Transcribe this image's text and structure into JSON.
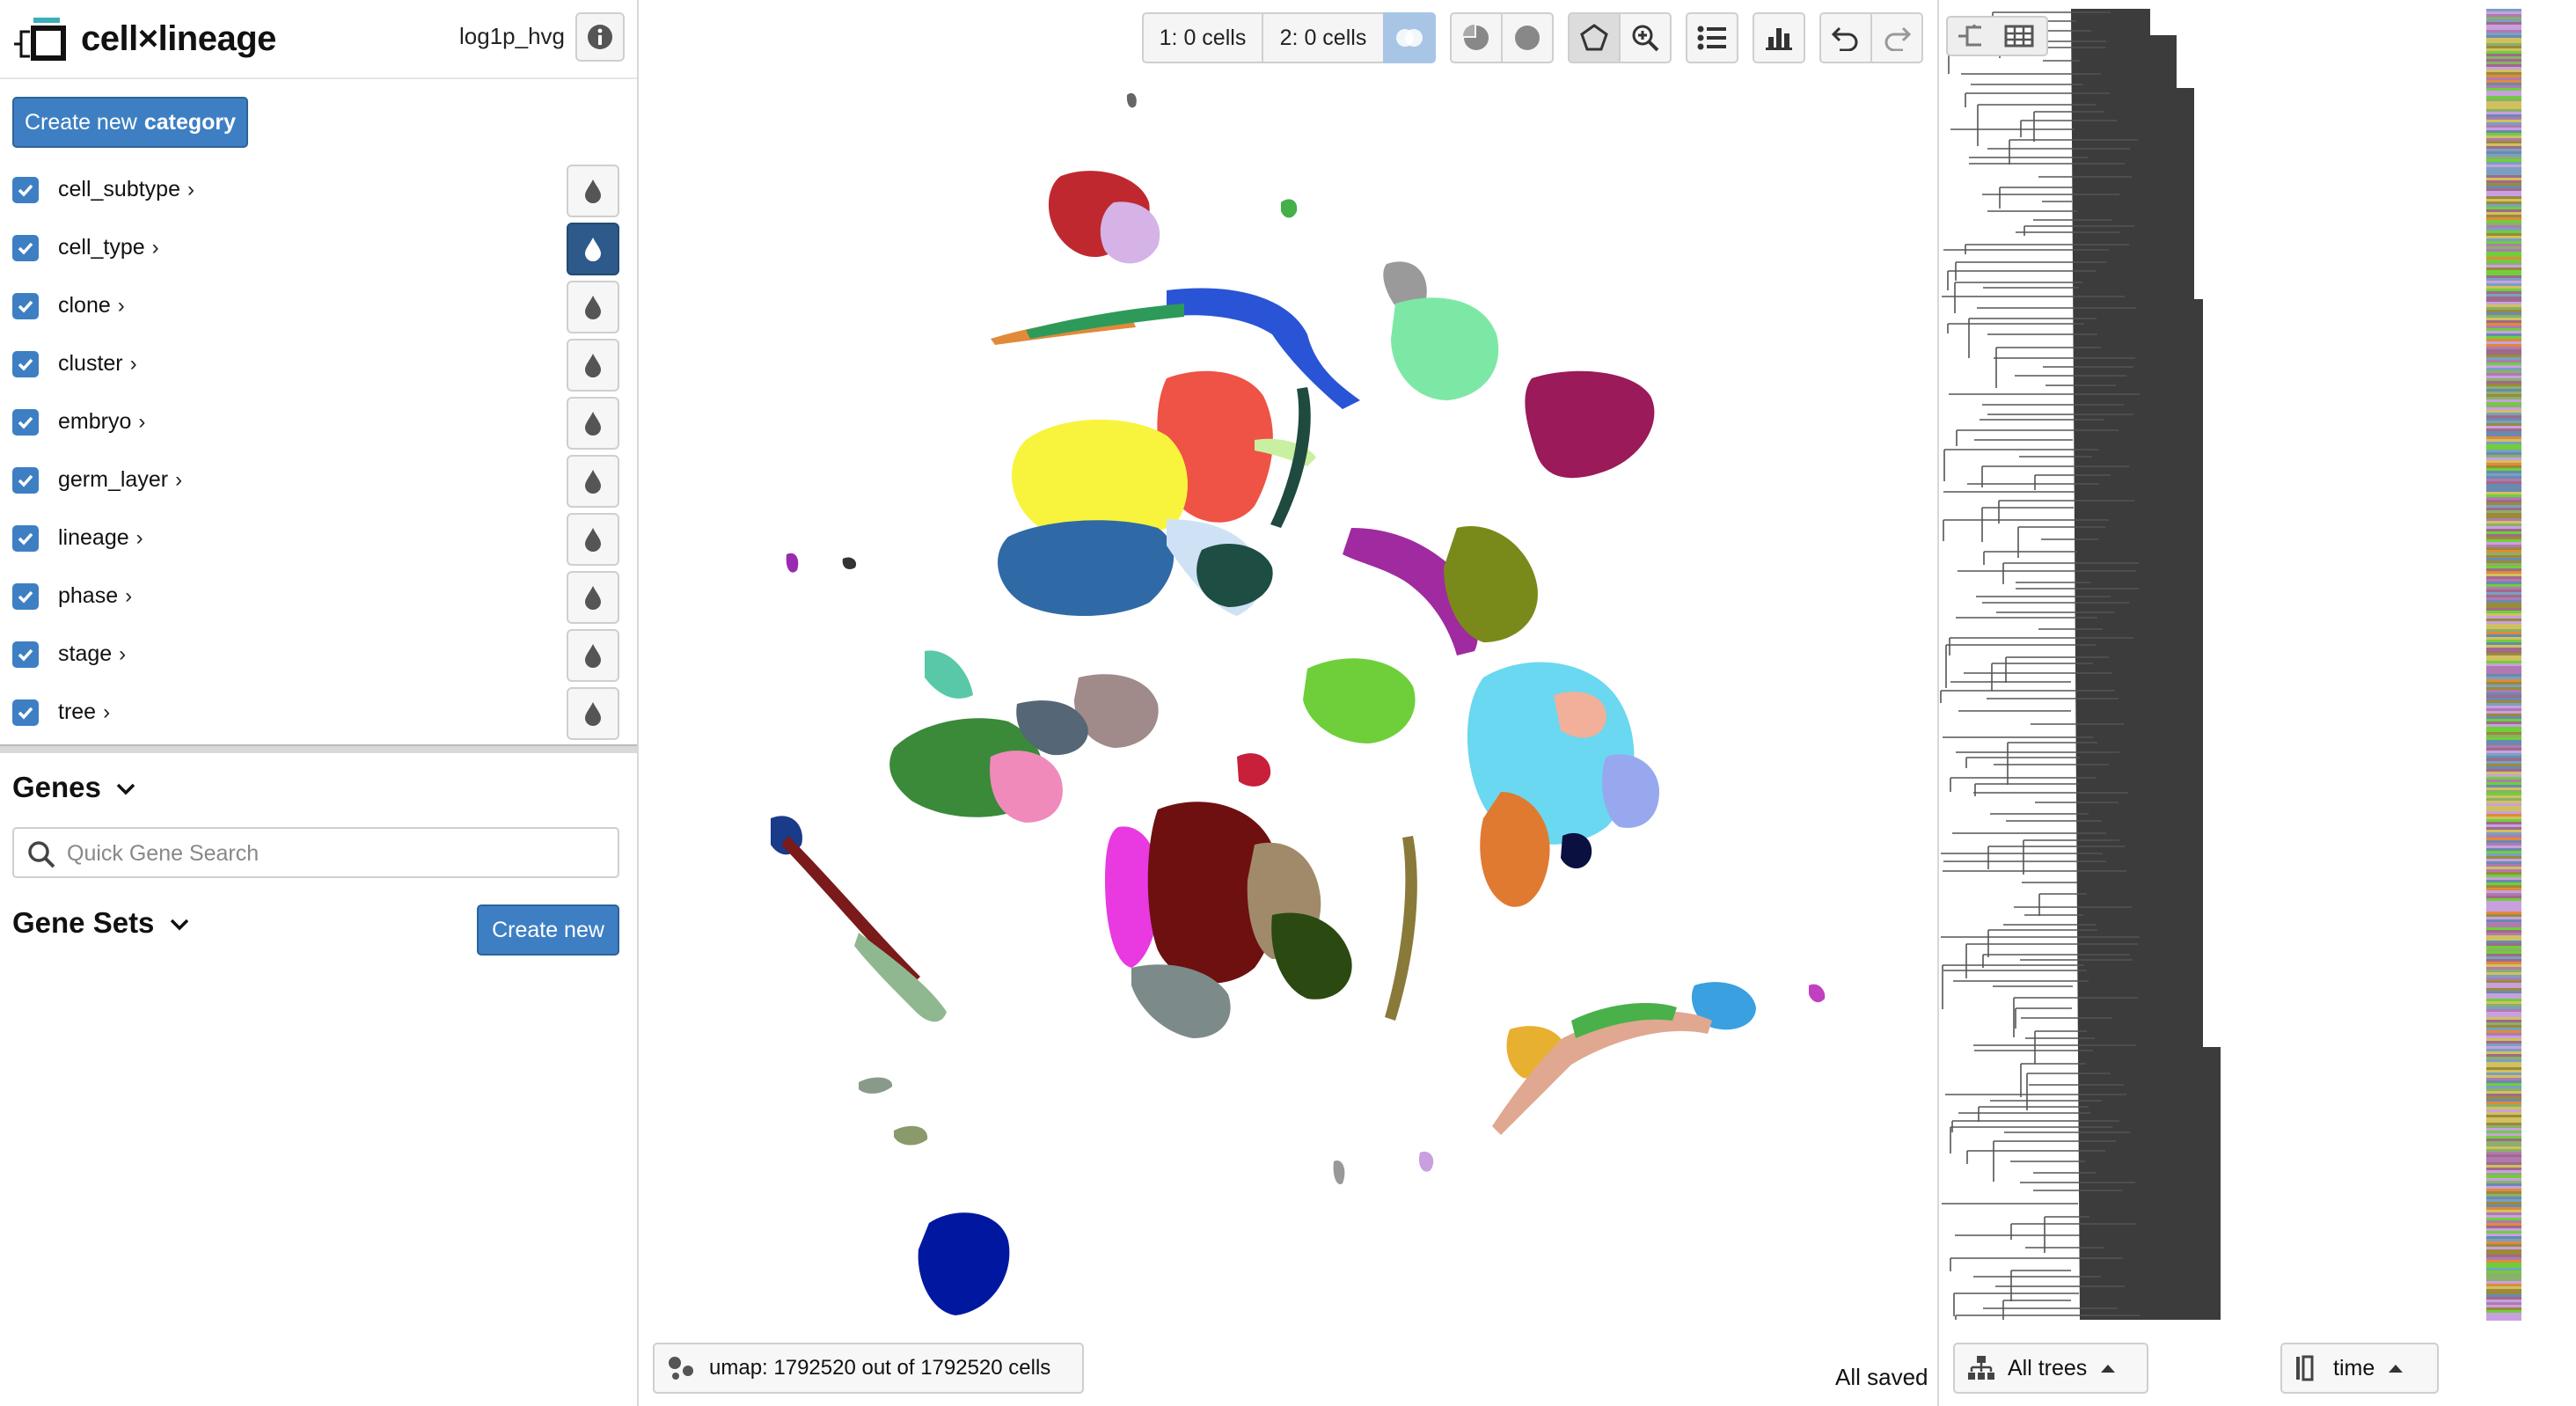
{
  "app": {
    "title": "cell×lineage",
    "layer": "log1p_hvg"
  },
  "categories": {
    "create_label_prefix": "Create new",
    "create_label_bold": "category",
    "items": [
      {
        "label": "cell_subtype",
        "checked": true,
        "active": false
      },
      {
        "label": "cell_type",
        "checked": true,
        "active": true
      },
      {
        "label": "clone",
        "checked": true,
        "active": false
      },
      {
        "label": "cluster",
        "checked": true,
        "active": false
      },
      {
        "label": "embryo",
        "checked": true,
        "active": false
      },
      {
        "label": "germ_layer",
        "checked": true,
        "active": false
      },
      {
        "label": "lineage",
        "checked": true,
        "active": false
      },
      {
        "label": "phase",
        "checked": true,
        "active": false
      },
      {
        "label": "stage",
        "checked": true,
        "active": false
      },
      {
        "label": "tree",
        "checked": true,
        "active": false
      }
    ]
  },
  "genes": {
    "title": "Genes",
    "search_placeholder": "Quick Gene Search"
  },
  "gene_sets": {
    "title": "Gene Sets",
    "create_label": "Create new"
  },
  "toolbar": {
    "selection_1": "1: 0 cells",
    "selection_2": "2: 0 cells",
    "icons": [
      "venn-icon",
      "pie-icon",
      "circle-icon",
      "lasso-icon",
      "zoom-icon",
      "list-icon",
      "histogram-icon",
      "undo-icon",
      "redo-icon"
    ]
  },
  "embedding": {
    "label": "umap: 1792520 out of 1792520 cells"
  },
  "status": {
    "save": "All saved"
  },
  "tree": {
    "trees_label": "All trees",
    "time_label": "time"
  },
  "colors": {
    "accent": "#3e7fc3",
    "active_color_btn": "#2d5a8a",
    "tree_fill": "#3c3c3c"
  }
}
